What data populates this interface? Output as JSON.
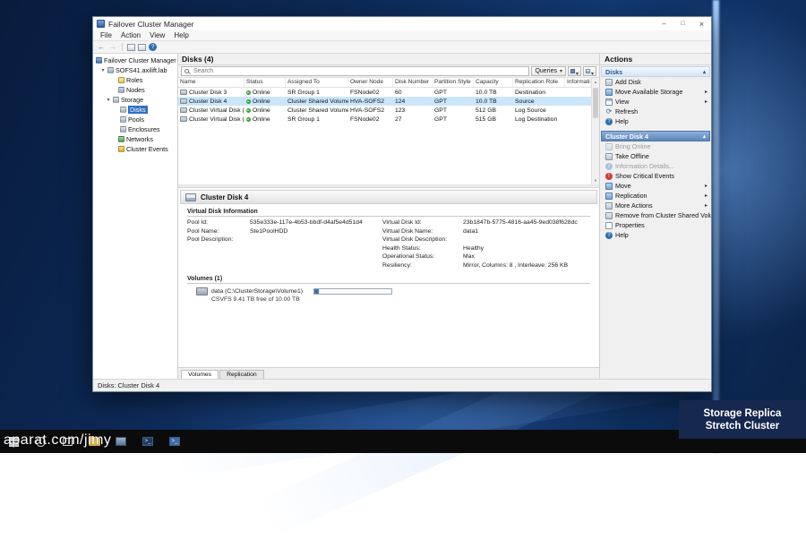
{
  "desktop": {
    "watermark": "aparat.com/jimy",
    "overlay_line1": "Storage Replica",
    "overlay_line2": "Stretch Cluster"
  },
  "window": {
    "title": "Failover Cluster Manager",
    "menu": [
      "File",
      "Action",
      "View",
      "Help"
    ],
    "status_bar": "Disks: Cluster Disk 4"
  },
  "tree": {
    "root": "Failover Cluster Manager",
    "cluster": "SOFS41.axilift.lab",
    "roles": "Roles",
    "nodes": "Nodes",
    "storage": "Storage",
    "disks": "Disks",
    "pools": "Pools",
    "enclosures": "Enclosures",
    "networks": "Networks",
    "cluster_events": "Cluster Events"
  },
  "disks_panel": {
    "title": "Disks (4)",
    "search_placeholder": "Search",
    "queries_label": "Queries",
    "columns": [
      "Name",
      "Status",
      "Assigned To",
      "Owner Node",
      "Disk Number",
      "Partition Style",
      "Capacity",
      "Replication Role",
      "Information"
    ],
    "rows": [
      {
        "name": "Cluster Disk 3",
        "status": "Online",
        "assigned_to": "SR Group 1",
        "owner_node": "FSNode02",
        "disk_number": "60",
        "partition_style": "GPT",
        "capacity": "10.0 TB",
        "replication_role": "Destination",
        "information": ""
      },
      {
        "name": "Cluster Disk 4",
        "status": "Online",
        "assigned_to": "Cluster Shared Volume",
        "owner_node": "HVA-SOFS2",
        "disk_number": "124",
        "partition_style": "GPT",
        "capacity": "10.0 TB",
        "replication_role": "Source",
        "information": ""
      },
      {
        "name": "Cluster Virtual Disk (c)",
        "status": "Online",
        "assigned_to": "Cluster Shared Volume",
        "owner_node": "HVA-SOFS2",
        "disk_number": "123",
        "partition_style": "GPT",
        "capacity": "512 GB",
        "replication_role": "Log Source",
        "information": ""
      },
      {
        "name": "Cluster Virtual Disk (d)",
        "status": "Online",
        "assigned_to": "SR Group 1",
        "owner_node": "FSNode02",
        "disk_number": "27",
        "partition_style": "GPT",
        "capacity": "515 GB",
        "replication_role": "Log Destination",
        "information": ""
      }
    ]
  },
  "detail": {
    "title": "Cluster Disk 4",
    "section_title": "Virtual Disk Information",
    "fields_left": [
      {
        "label": "Pool Id:",
        "value": "535e333e-117e-4b53-bbdf-d4af5e4d51d4"
      },
      {
        "label": "Pool Name:",
        "value": "Ste1PoolHDD"
      },
      {
        "label": "Pool Description:",
        "value": ""
      }
    ],
    "fields_right": [
      {
        "label": "Virtual Disk Id:",
        "value": "23b1847b-5775-4816-aa45-9ed038f628dc"
      },
      {
        "label": "Virtual Disk Name:",
        "value": "data1"
      },
      {
        "label": "Virtual Disk Description:",
        "value": ""
      },
      {
        "label": "Health Status:",
        "value": "Healthy"
      },
      {
        "label": "Operational Status:",
        "value": "Max"
      },
      {
        "label": "Resiliency:",
        "value": "Mirror, Columns: 8 , Interleave: 256 KB"
      }
    ],
    "volumes_title": "Volumes (1)",
    "volume_name": "data (C:\\ClusterStorage\\Volume1)",
    "volume_info": "CSVFS 9.41 TB free of 10.00 TB",
    "tabs": [
      "Volumes",
      "Replication"
    ]
  },
  "actions": {
    "title": "Actions",
    "sections": [
      {
        "title": "Disks",
        "items": [
          {
            "label": "Add Disk"
          },
          {
            "label": "Move Available Storage"
          },
          {
            "label": "View"
          },
          {
            "label": "Refresh"
          },
          {
            "label": "Help"
          }
        ]
      },
      {
        "title": "Cluster Disk 4",
        "items": [
          {
            "label": "Bring Online"
          },
          {
            "label": "Take Offline"
          },
          {
            "label": "Information Details..."
          },
          {
            "label": "Show Critical Events"
          },
          {
            "label": "Move"
          },
          {
            "label": "Replication"
          },
          {
            "label": "More Actions"
          },
          {
            "label": "Remove from Cluster Shared Volumes"
          },
          {
            "label": "Properties"
          },
          {
            "label": "Help"
          }
        ]
      }
    ]
  }
}
